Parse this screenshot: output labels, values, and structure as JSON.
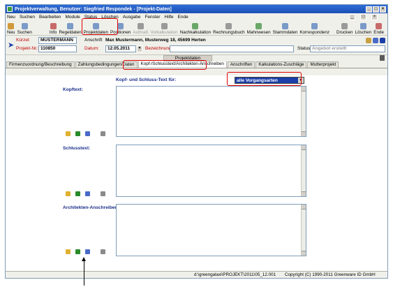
{
  "window": {
    "title": "Projektverwaltung, Benutzer: Siegfried Respondek - [Projekt-Daten]"
  },
  "menu": [
    "Neu",
    "Suchen",
    "Bearbeiten",
    "Module",
    "Status",
    "Löschen",
    "Ausgabe",
    "Fenster",
    "Hilfe",
    "Ende"
  ],
  "toolbar": {
    "buttons": [
      {
        "label": "Neu",
        "enabled": true
      },
      {
        "label": "Suchen",
        "enabled": true
      },
      {
        "label": "Info",
        "enabled": true
      },
      {
        "label": "Regeldaten",
        "enabled": true
      },
      {
        "label": "Projektdaten",
        "enabled": true
      },
      {
        "label": "Positionen",
        "enabled": true
      },
      {
        "label": "Aufmaß",
        "enabled": false
      },
      {
        "label": "Vorkalkulation",
        "enabled": false
      },
      {
        "label": "Nachkalkulation",
        "enabled": true
      },
      {
        "label": "Rechnungsbuch",
        "enabled": true
      },
      {
        "label": "Mahnwesen",
        "enabled": true
      },
      {
        "label": "Stammdaten",
        "enabled": true
      },
      {
        "label": "Korrespondenz",
        "enabled": true
      },
      {
        "label": "Drucken",
        "enabled": true
      },
      {
        "label": "Löschen",
        "enabled": true
      },
      {
        "label": "Ende",
        "enabled": true
      }
    ]
  },
  "header": {
    "kurzel_label": "Kürzel:",
    "kurzel_value": "MUSTERMANN",
    "projekt_nr_label": "Projekt-Nr.:",
    "projekt_nr_value": "110850",
    "anschrift_label": "Anschrift",
    "anschrift_value": "Max Mustermann, Musterweg 18, 45699 Herten",
    "datum_label": "Datum:",
    "datum_value": "12.05.2011",
    "bezeichnung_label": "Bezeichnung:",
    "bezeichnung_value": "",
    "status_label": "Status:",
    "status_value": "Angebot erstellt"
  },
  "section_title": "Projektdaten",
  "tabs": [
    {
      "label": "Firmenzuordnung/Beschreibung",
      "active": false
    },
    {
      "label": "Zahlungsbedingungen/Daten",
      "active": false
    },
    {
      "label": "Kopf-/Schlusstext/Architekten-Anschreiben",
      "active": true
    },
    {
      "label": "Anschriften",
      "active": false
    },
    {
      "label": "Kalkulations-Zuschläge",
      "active": false
    },
    {
      "label": "Mutterprojekt",
      "active": false
    }
  ],
  "content": {
    "text_for_label": "Kopf- und Schluss-Text für:",
    "text_for_value": "alle Vorgangsarten",
    "kopftext_label": "Kopftext:",
    "schlusstext_label": "Schlusstext:",
    "architekten_label": "Architekten-Anschreiben:"
  },
  "statusbar": {
    "path": "d:\\greengalaxi\\PROJEKT\\2011\\05_12.001",
    "copyright": "Copyright (C) 1990-2011 Greenware ID GmbH"
  },
  "colors": {
    "title_bar": "#1b4fb4",
    "label_red": "#c00000",
    "section_label_blue": "#1b2f8a",
    "annotation_red": "#e00000",
    "select_highlight": "#1b3fa8"
  }
}
